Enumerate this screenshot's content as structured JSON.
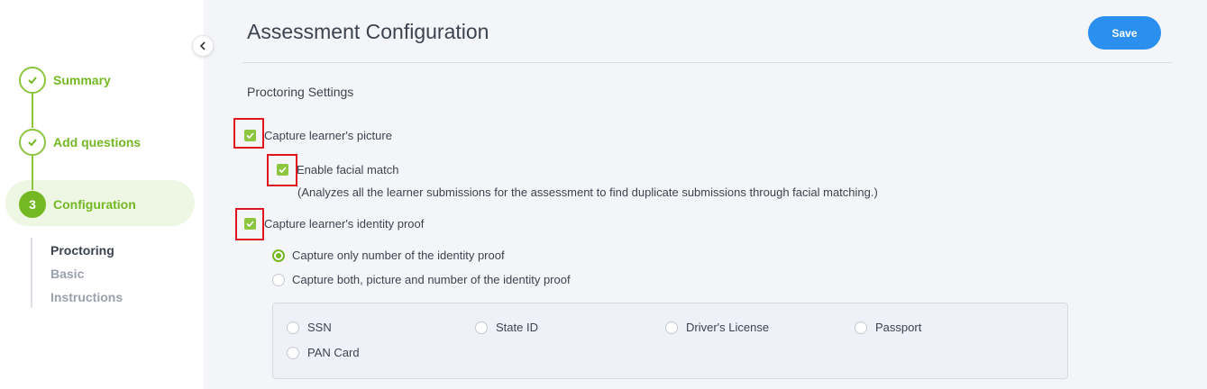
{
  "sidebar": {
    "steps": [
      {
        "label": "Summary",
        "state": "done"
      },
      {
        "label": "Add questions",
        "state": "done"
      },
      {
        "label": "Configuration",
        "state": "active",
        "number": "3"
      }
    ],
    "substeps": [
      {
        "label": "Proctoring",
        "active": true
      },
      {
        "label": "Basic",
        "active": false
      },
      {
        "label": "Instructions",
        "active": false
      }
    ]
  },
  "header": {
    "title": "Assessment Configuration",
    "save_label": "Save"
  },
  "proctoring": {
    "section_title": "Proctoring Settings",
    "capture_picture": {
      "label": "Capture learner's picture",
      "checked": true
    },
    "facial_match": {
      "label": "Enable facial match",
      "checked": true
    },
    "facial_match_note": "(Analyzes all the learner submissions for the assessment to find duplicate submissions through facial matching.)",
    "capture_identity": {
      "label": "Capture learner's identity proof",
      "checked": true
    },
    "identity_modes": [
      {
        "label": "Capture only number of the identity proof",
        "selected": true
      },
      {
        "label": "Capture both, picture and number of the identity proof",
        "selected": false
      }
    ],
    "id_types": [
      "SSN",
      "State ID",
      "Driver's License",
      "Passport",
      "PAN Card"
    ]
  },
  "colors": {
    "accent_green": "#74b823",
    "checkbox_green": "#8cc63f",
    "save_blue": "#2b8ff0",
    "highlight_red": "#e0141e"
  }
}
